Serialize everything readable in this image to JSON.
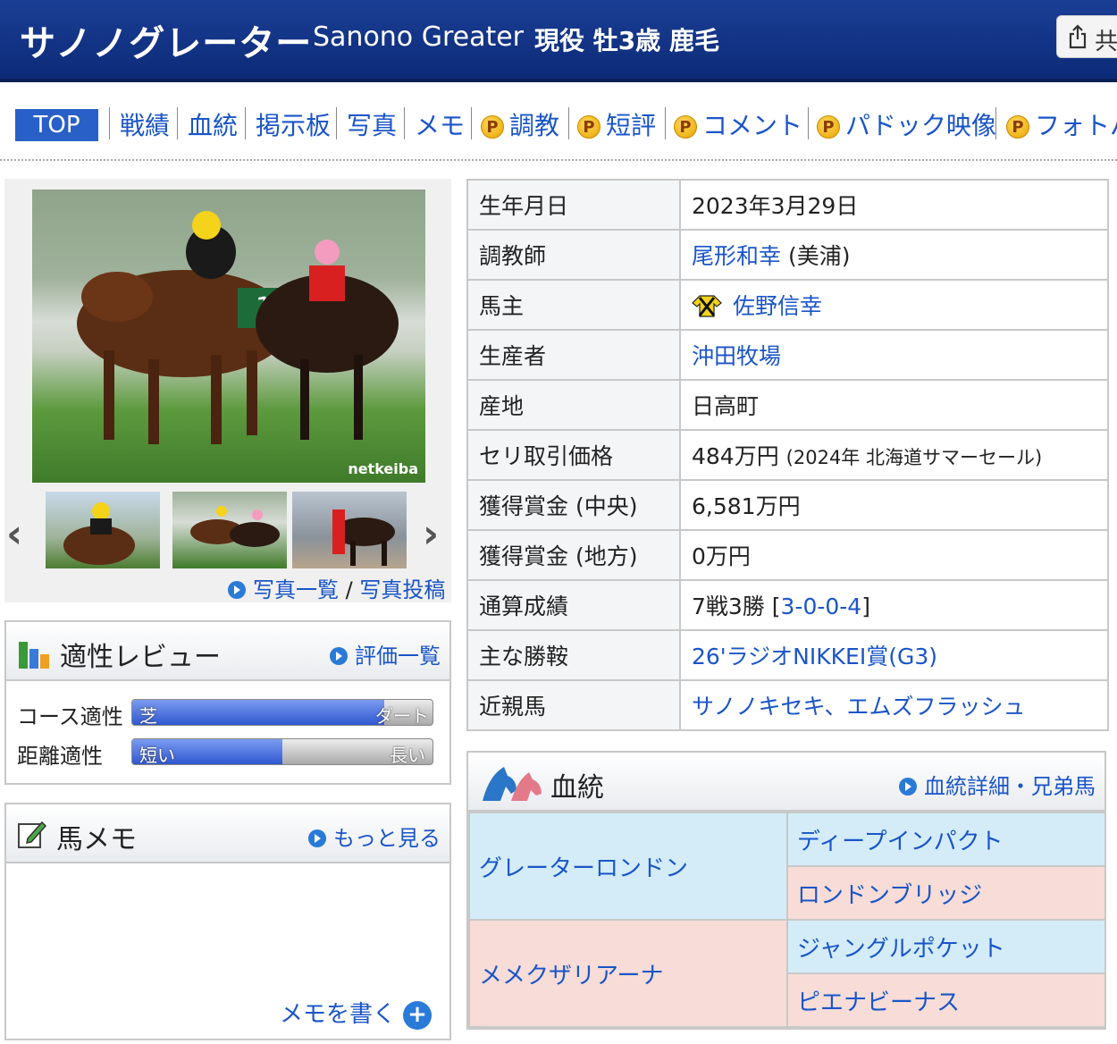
{
  "header": {
    "name_jp": "サノノグレーター",
    "name_en": "Sanono Greater",
    "meta": "現役 牡3歳 鹿毛",
    "share_label": "共"
  },
  "nav": {
    "top": "TOP",
    "items": [
      "戦績",
      "血統",
      "掲示板",
      "写真",
      "メモ"
    ],
    "premium_items": [
      "調教",
      "短評",
      "コメント",
      "パドック映像",
      "フォトパ"
    ],
    "premium_badge": "P"
  },
  "photos": {
    "watermark": "netkeiba",
    "links_list": "写真一覧",
    "links_sep": "/",
    "links_post": "写真投稿",
    "prev_arrow": "‹",
    "next_arrow": "›"
  },
  "review": {
    "title": "適性レビュー",
    "more": "評価一覧",
    "course_label": "コース適性",
    "course_left": "芝",
    "course_right": "ダート",
    "course_level": 0.84,
    "distance_label": "距離適性",
    "distance_left": "短い",
    "distance_right": "長い",
    "distance_level": 0.5
  },
  "memo": {
    "title": "馬メモ",
    "more": "もっと見る",
    "write": "メモを書く",
    "write_icon": "+"
  },
  "profile": {
    "rows": [
      {
        "key": "生年月日",
        "value": "2023年3月29日"
      },
      {
        "key": "調教師",
        "link": "尾形和幸",
        "value": " (美浦)"
      },
      {
        "key": "馬主",
        "link": "佐野信幸"
      },
      {
        "key": "生産者",
        "link": "沖田牧場"
      },
      {
        "key": "産地",
        "value": "日高町"
      },
      {
        "key": "セリ取引価格",
        "value": "484万円 ",
        "note": "(2024年 北海道サマーセール)"
      },
      {
        "key": "獲得賞金 (中央)",
        "value": "6,581万円"
      },
      {
        "key": "獲得賞金 (地方)",
        "value": "0万円"
      },
      {
        "key": "通算成績",
        "value": "7戦3勝 [",
        "link": "3-0-0-4",
        "value2": "]"
      },
      {
        "key": "主な勝鞍",
        "link": "26'ラジオNIKKEI賞(G3)"
      },
      {
        "key": "近親馬",
        "link": "サノノキセキ、エムズフラッシュ"
      }
    ]
  },
  "pedigree": {
    "title": "血統",
    "more": "血統詳細・兄弟馬",
    "sire": "グレーターロンドン",
    "sire_sire": "ディープインパクト",
    "sire_dam": "ロンドンブリッジ",
    "dam": "メメクザリアーナ",
    "dam_sire": "ジャングルポケット",
    "dam_dam": "ピエナビーナス"
  },
  "colors": {
    "header_bg": "#0c2a78",
    "link": "#1a55c8",
    "top_tab": "#2960c7",
    "sire_bg": "#d3ecf8",
    "dam_bg": "#f7dcd7"
  }
}
